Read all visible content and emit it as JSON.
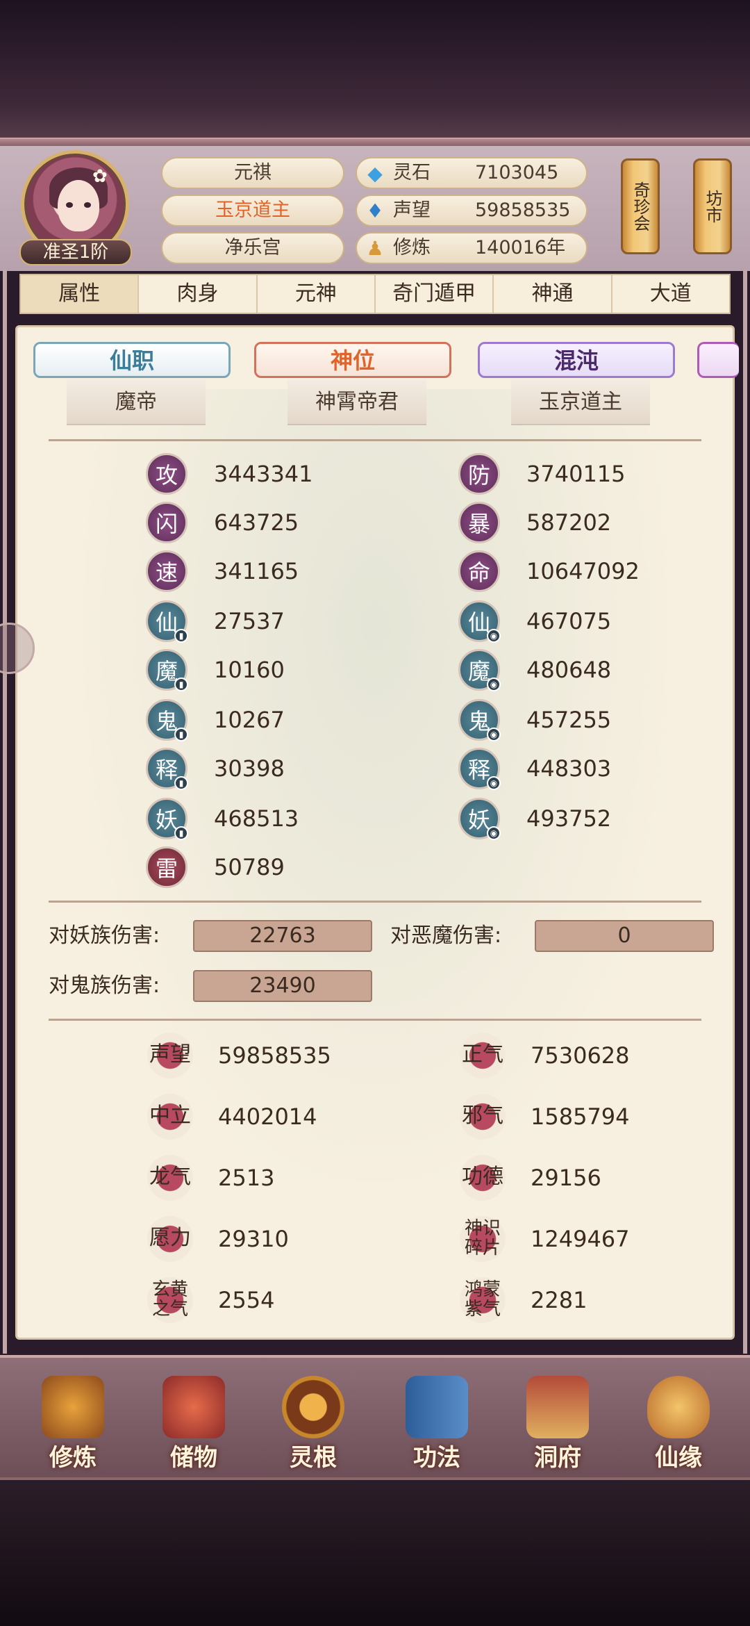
{
  "header": {
    "rank": "准圣1阶",
    "name_pills": [
      "元祺",
      "玉京道主",
      "净乐宫"
    ],
    "resources": [
      {
        "label": "灵石",
        "value": "7103045",
        "icon": "spirit-stone-icon"
      },
      {
        "label": "声望",
        "value": "59858535",
        "icon": "reputation-crystal-icon"
      },
      {
        "label": "修炼",
        "value": "140016年",
        "icon": "meditation-icon"
      }
    ],
    "scroll_buttons": [
      "奇珍会",
      "坊市"
    ]
  },
  "tabs": [
    "属性",
    "肉身",
    "元神",
    "奇门遁甲",
    "神通",
    "大道"
  ],
  "titles": [
    {
      "badge": "仙职",
      "value": "魔帝"
    },
    {
      "badge": "神位",
      "value": "神霄帝君"
    },
    {
      "badge": "混沌",
      "value": "玉京道主"
    }
  ],
  "stats_left": [
    {
      "icon": "攻",
      "value": "3443341"
    },
    {
      "icon": "闪",
      "value": "643725"
    },
    {
      "icon": "速",
      "value": "341165"
    },
    {
      "icon": "仙",
      "value": "27537"
    },
    {
      "icon": "魔",
      "value": "10160"
    },
    {
      "icon": "鬼",
      "value": "10267"
    },
    {
      "icon": "释",
      "value": "30398"
    },
    {
      "icon": "妖",
      "value": "468513"
    },
    {
      "icon": "雷",
      "value": "50789"
    }
  ],
  "stats_right": [
    {
      "icon": "防",
      "value": "3740115"
    },
    {
      "icon": "暴",
      "value": "587202"
    },
    {
      "icon": "命",
      "value": "10647092"
    },
    {
      "icon": "仙",
      "value": "467075"
    },
    {
      "icon": "魔",
      "value": "480648"
    },
    {
      "icon": "鬼",
      "value": "457255"
    },
    {
      "icon": "释",
      "value": "448303"
    },
    {
      "icon": "妖",
      "value": "493752"
    }
  ],
  "damage": [
    {
      "label": "对妖族伤害:",
      "value": "22763"
    },
    {
      "label": "对恶魔伤害:",
      "value": "0"
    },
    {
      "label": "对鬼族伤害:",
      "value": "23490"
    }
  ],
  "reputation_left": [
    {
      "icon": "声望",
      "value": "59858535"
    },
    {
      "icon": "中立",
      "value": "4402014"
    },
    {
      "icon": "龙气",
      "value": "2513"
    },
    {
      "icon": "愿力",
      "value": "29310"
    },
    {
      "icon": "玄黄之气",
      "value": "2554"
    }
  ],
  "reputation_right": [
    {
      "icon": "正气",
      "value": "7530628"
    },
    {
      "icon": "邪气",
      "value": "1585794"
    },
    {
      "icon": "功德",
      "value": "29156"
    },
    {
      "icon": "神识碎片",
      "value": "1249467"
    },
    {
      "icon": "鸿蒙紫气",
      "value": "2281"
    }
  ],
  "nav": [
    "修炼",
    "储物",
    "灵根",
    "功法",
    "洞府",
    "仙缘"
  ],
  "colors": {
    "accent_orange": "#e0632a",
    "panel_bg": "#f7f0e0",
    "stat_purple": "#7a3f74",
    "stat_teal": "#4a7888",
    "stat_red": "#8e3a4a"
  }
}
